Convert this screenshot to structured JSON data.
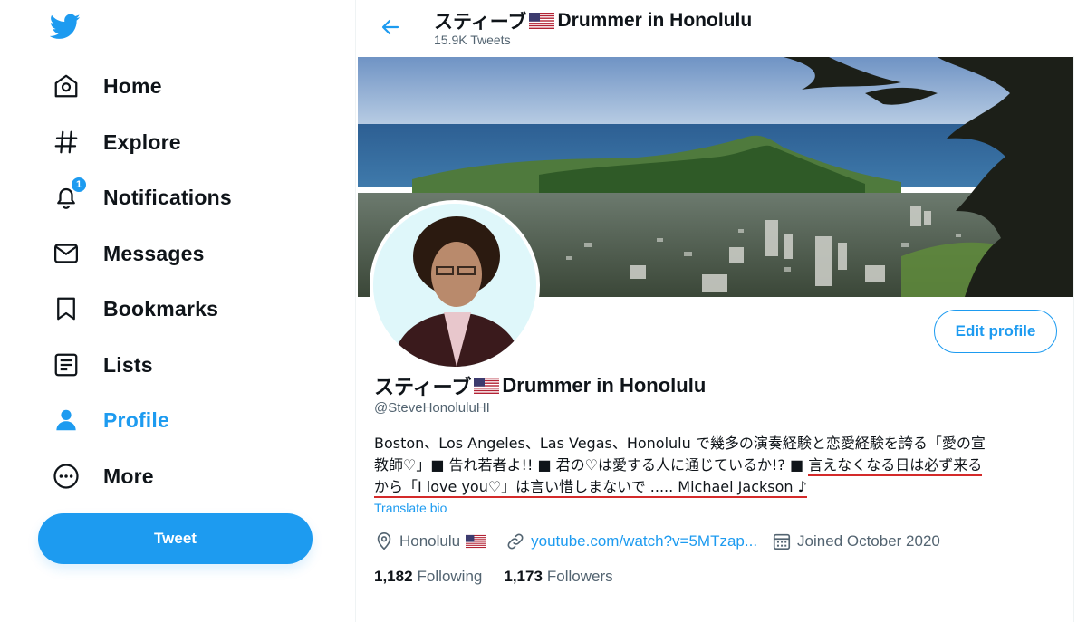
{
  "sidebar": {
    "logo_icon": "twitter-bird-icon",
    "items": [
      {
        "label": "Home",
        "icon": "home-icon"
      },
      {
        "label": "Explore",
        "icon": "hashtag-icon"
      },
      {
        "label": "Notifications",
        "icon": "bell-icon",
        "badge": "1"
      },
      {
        "label": "Messages",
        "icon": "envelope-icon"
      },
      {
        "label": "Bookmarks",
        "icon": "bookmark-icon"
      },
      {
        "label": "Lists",
        "icon": "list-icon"
      },
      {
        "label": "Profile",
        "icon": "person-icon",
        "active": true
      },
      {
        "label": "More",
        "icon": "more-icon"
      }
    ],
    "tweet_label": "Tweet"
  },
  "header": {
    "title_prefix": "スティーブ",
    "title_suffix": "Drummer in Honolulu",
    "tweet_count": "15.9K Tweets"
  },
  "profile": {
    "name_prefix": "スティーブ",
    "name_suffix": "Drummer in Honolulu",
    "handle": "@SteveHonoluluHI",
    "edit_profile_label": "Edit profile",
    "bio": {
      "line1": "Boston、Los Angeles、Las Vegas、Honolulu で幾多の演奏経験と恋愛経験を誇る「愛の宣",
      "line2_plain": "教師♡」■ 告れ若者よ!! ■ 君の♡は愛する人に通じているか!? ■ ",
      "line2_underlined": "言えなくなる日は必ず来る",
      "line3_underlined": "から「I love you♡」は言い惜しまないで ..... Michael Jackson ♪"
    },
    "translate_bio": "Translate bio",
    "location": "Honolulu",
    "website": "youtube.com/watch?v=5MTzap...",
    "joined": "Joined October 2020",
    "following_count": "1,182",
    "following_label": "Following",
    "followers_count": "1,173",
    "followers_label": "Followers"
  },
  "colors": {
    "accent": "#1d9bf0",
    "text_primary": "#0f1419",
    "text_secondary": "#536471",
    "annotation_red": "#d42a2a"
  }
}
